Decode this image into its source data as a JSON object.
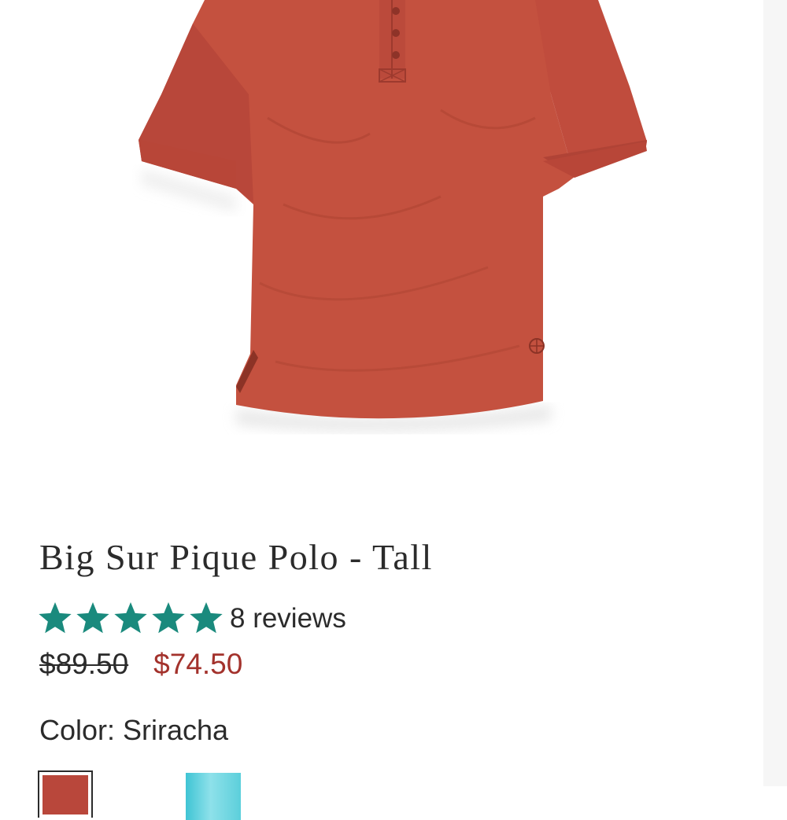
{
  "product": {
    "title": "Big Sur Pique Polo - Tall",
    "image_icon": "polo-shirt-image",
    "garment_color": "#c4513f"
  },
  "rating": {
    "stars": 5,
    "max_stars": 5,
    "star_color": "#1a8a7d",
    "reviews_label": "8 reviews"
  },
  "price": {
    "original": "$89.50",
    "sale": "$74.50",
    "sale_color": "#a3322c"
  },
  "color": {
    "label": "Color:",
    "value": "Sriracha",
    "swatches": [
      {
        "name": "Sriracha",
        "color": "#b9473b",
        "selected": true
      },
      {
        "name": "aqua-swatch",
        "color": "#5ccfdb",
        "selected": false
      }
    ]
  }
}
